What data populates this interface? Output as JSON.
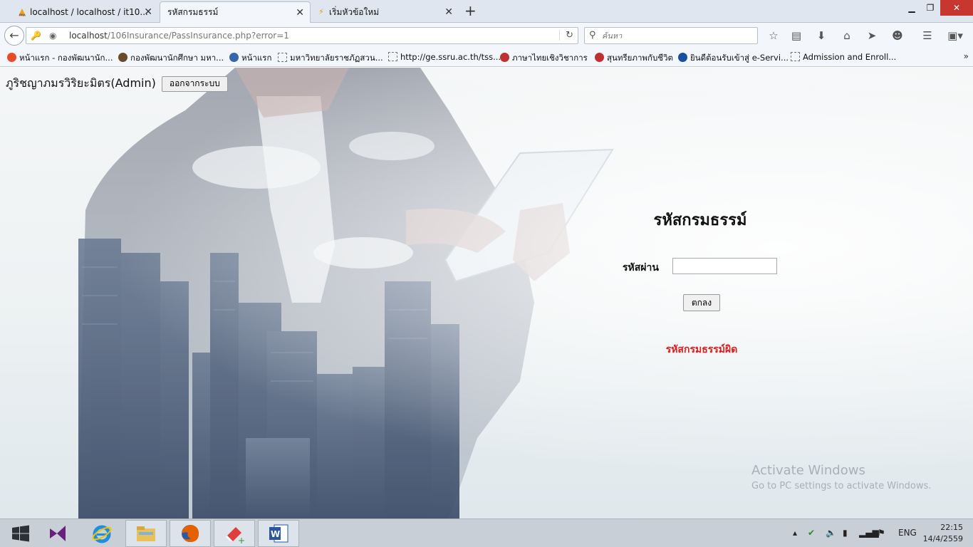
{
  "browser": {
    "tabs": [
      {
        "label": "localhost / localhost / it10...",
        "icon": "phpmyadmin-icon",
        "active": false
      },
      {
        "label": "รหัสกรมธรรม์",
        "icon": "",
        "active": true
      },
      {
        "label": "เริ่มหัวข้อใหม่",
        "icon": "lightning-icon",
        "active": false
      }
    ],
    "url_host": "localhost",
    "url_path": "/106Insurance/PassInsurance.php?error=1",
    "search_placeholder": "ค้นหา",
    "bookmarks": [
      {
        "label": "หน้าแรก - กองพัฒนานัก...",
        "icon": "joomla-icon"
      },
      {
        "label": "กองพัฒนานักศึกษา มหา...",
        "icon": "seal-icon"
      },
      {
        "label": "หน้าแรก",
        "icon": "globe-icon"
      },
      {
        "label": "มหาวิทยาลัยราชภัฏสวน...",
        "icon": "page-icon"
      },
      {
        "label": "http://ge.ssru.ac.th/tss...",
        "icon": "page-icon"
      },
      {
        "label": "ภาษาไทยเชิงวิชาการ",
        "icon": "seal-icon"
      },
      {
        "label": "สุนทรียภาพกับชีวิต",
        "icon": "seal-icon"
      },
      {
        "label": "ยินดีต้อนรับเข้าสู่ e-Servi...",
        "icon": "service-icon"
      },
      {
        "label": "Admission and Enroll...",
        "icon": "page-icon"
      }
    ]
  },
  "page": {
    "user_name": "ภูริชญาภมรวิริยะมิตร(Admin)",
    "logout_label": "ออกจากระบบ",
    "form_title": "รหัสกรมธรรม์",
    "password_label": "รหัสผ่าน",
    "password_value": "",
    "ok_label": "ตกลง",
    "error_message": "รหัสกรมธรรม์ผิด"
  },
  "watermark": {
    "line1": "Activate Windows",
    "line2": "Go to PC settings to activate Windows."
  },
  "taskbar": {
    "apps": [
      "windows-start-icon",
      "visual-studio-icon",
      "internet-explorer-icon",
      "file-explorer-icon",
      "firefox-icon",
      "eraser-app-icon",
      "word-icon"
    ],
    "language": "ENG",
    "time": "22:15",
    "date": "14/4/2559"
  },
  "colors": {
    "error": "#e01b1b",
    "close_button": "#c7372f"
  }
}
